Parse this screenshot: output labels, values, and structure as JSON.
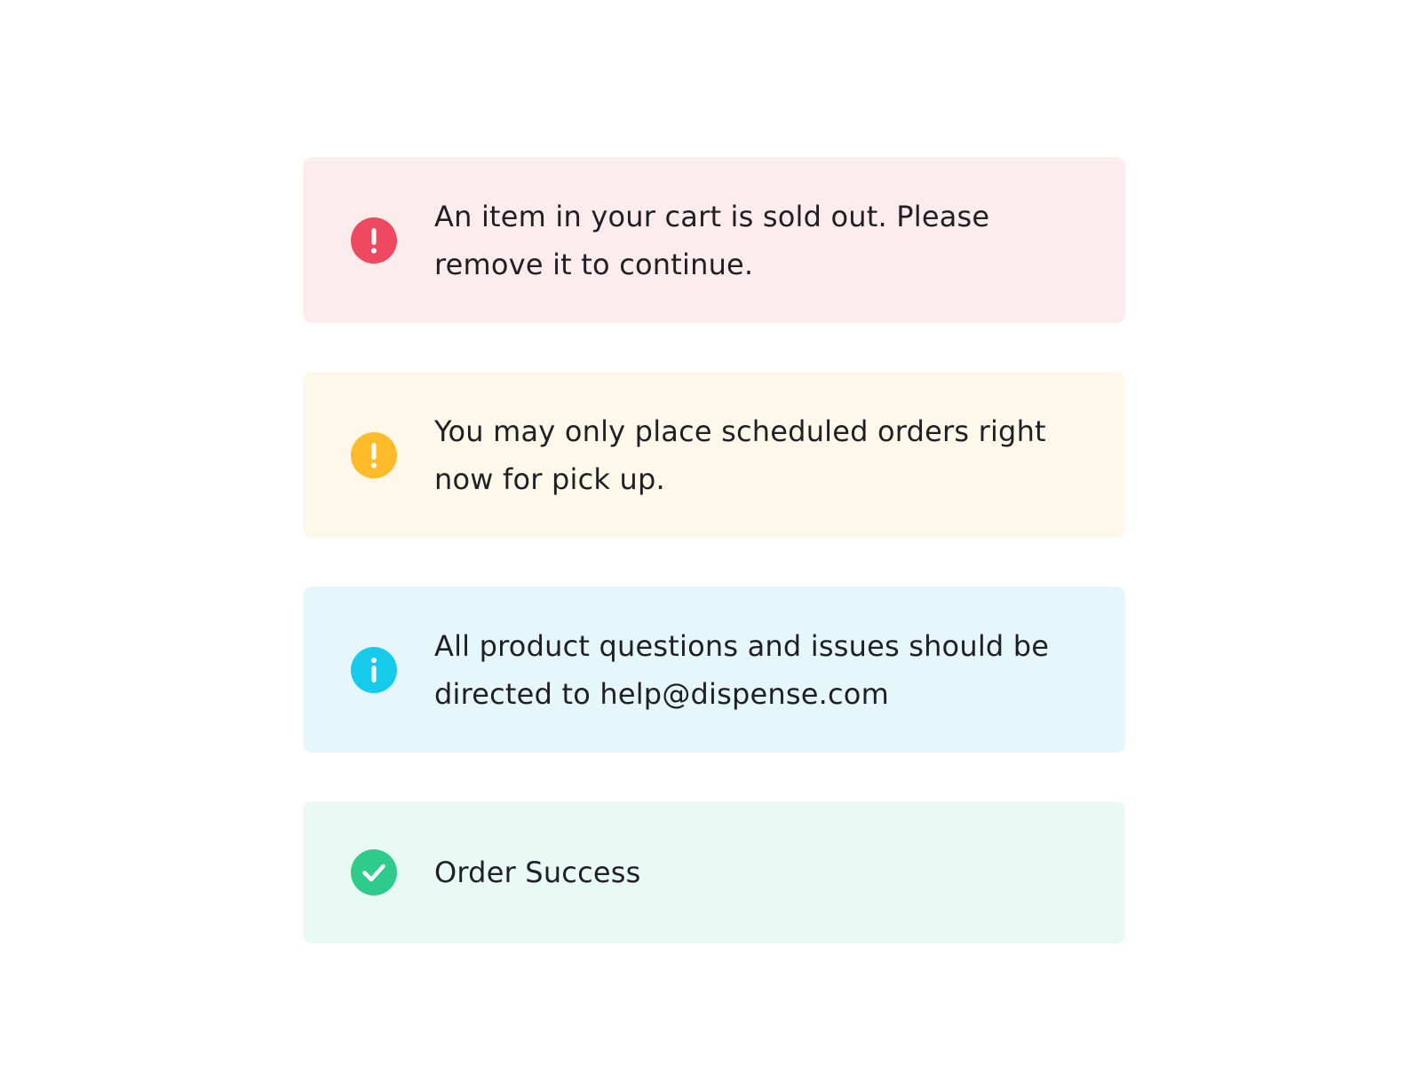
{
  "alerts": [
    {
      "type": "error",
      "message": "An item in your cart is sold out. Please\nremove it to continue.",
      "icon": "exclamation-icon",
      "background": "#fdecee",
      "icon_color": "#ef4962"
    },
    {
      "type": "warning",
      "message": "You may only place scheduled orders right\nnow for pick up.",
      "icon": "exclamation-icon",
      "background": "#fdf8e9",
      "icon_color": "#ffbb29"
    },
    {
      "type": "info",
      "message": "All product questions and issues should be\ndirected to help@dispense.com",
      "icon": "info-icon",
      "background": "#e6f7fc",
      "icon_color": "#16cbea"
    },
    {
      "type": "success",
      "message": "Order Success",
      "icon": "checkmark-icon",
      "background": "#e8faf3",
      "icon_color": "#2ecb8d"
    }
  ]
}
